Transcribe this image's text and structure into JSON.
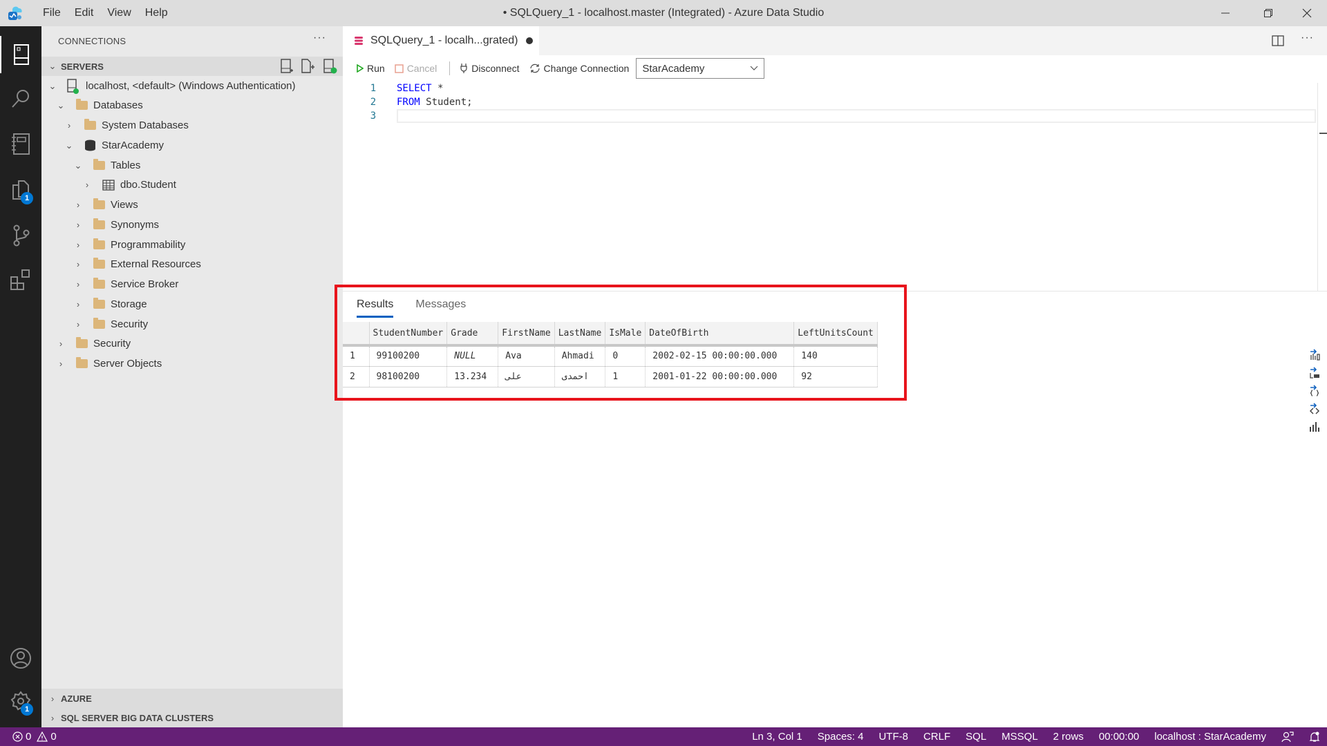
{
  "titlebar": {
    "menus": [
      "File",
      "Edit",
      "View",
      "Help"
    ],
    "title": "• SQLQuery_1 - localhost.master (Integrated) - Azure Data Studio",
    "minimize": "—",
    "restore": "❐",
    "close": "✕"
  },
  "activitybar": {
    "items": [
      "connections-icon",
      "search-icon",
      "notebooks-icon",
      "explorer-icon",
      "source-control-icon",
      "extensions-icon"
    ],
    "explorer_badge": "1",
    "settings_badge": "1"
  },
  "sidebar": {
    "title": "CONNECTIONS",
    "more": "···",
    "servers_header": "SERVERS",
    "tree": [
      {
        "label": "localhost, <default> (Windows Authentication)",
        "icon": "server",
        "state": "expanded"
      },
      {
        "label": "Databases",
        "icon": "folder",
        "state": "expanded"
      },
      {
        "label": "System Databases",
        "icon": "folder",
        "state": "collapsed"
      },
      {
        "label": "StarAcademy",
        "icon": "database",
        "state": "expanded"
      },
      {
        "label": "Tables",
        "icon": "folder",
        "state": "expanded"
      },
      {
        "label": "dbo.Student",
        "icon": "table",
        "state": "collapsed"
      },
      {
        "label": "Views",
        "icon": "folder",
        "state": "collapsed"
      },
      {
        "label": "Synonyms",
        "icon": "folder",
        "state": "collapsed"
      },
      {
        "label": "Programmability",
        "icon": "folder",
        "state": "collapsed"
      },
      {
        "label": "External Resources",
        "icon": "folder",
        "state": "collapsed"
      },
      {
        "label": "Service Broker",
        "icon": "folder",
        "state": "collapsed"
      },
      {
        "label": "Storage",
        "icon": "folder",
        "state": "collapsed"
      },
      {
        "label": "Security",
        "icon": "folder",
        "state": "collapsed"
      },
      {
        "label": "Security",
        "icon": "folder",
        "state": "collapsed"
      },
      {
        "label": "Server Objects",
        "icon": "folder",
        "state": "collapsed"
      }
    ],
    "azure_header": "AZURE",
    "bdc_header": "SQL SERVER BIG DATA CLUSTERS"
  },
  "editor": {
    "tab_label": "SQLQuery_1 - localh...grated)",
    "toolbar": {
      "run": "Run",
      "cancel": "Cancel",
      "disconnect": "Disconnect",
      "change_connection": "Change Connection",
      "database": "StarAcademy"
    },
    "lines": [
      {
        "n": "1",
        "kw": "SELECT",
        "rest": " *"
      },
      {
        "n": "2",
        "kw": "FROM",
        "rest": " Student;"
      },
      {
        "n": "3",
        "kw": "",
        "rest": ""
      }
    ]
  },
  "results": {
    "tabs": [
      "Results",
      "Messages"
    ],
    "columns": [
      "StudentNumber",
      "Grade",
      "FirstName",
      "LastName",
      "IsMale",
      "DateOfBirth",
      "LeftUnitsCount"
    ],
    "rows": [
      [
        "1",
        "99100200",
        "NULL",
        "Ava",
        "Ahmadi",
        "0",
        "2002-02-15 00:00:00.000",
        "140"
      ],
      [
        "2",
        "98100200",
        "13.234",
        "علی",
        "احمدی",
        "1",
        "2001-01-22 00:00:00.000",
        "92"
      ]
    ],
    "side_actions": [
      "save-as-csv-icon",
      "save-as-excel-icon",
      "save-as-json-icon",
      "save-as-xml-icon",
      "chart-icon"
    ]
  },
  "statusbar": {
    "errors": "0",
    "warnings": "0",
    "position": "Ln 3, Col 1",
    "spaces": "Spaces: 4",
    "encoding": "UTF-8",
    "eol": "CRLF",
    "language": "SQL",
    "provider": "MSSQL",
    "rows": "2 rows",
    "elapsed": "00:00:00",
    "connection": "localhost : StarAcademy"
  },
  "colors": {
    "statusbar": "#652076",
    "accent": "#0078d4",
    "highlight_box": "#e8141c",
    "keyword": "#0000ff"
  }
}
